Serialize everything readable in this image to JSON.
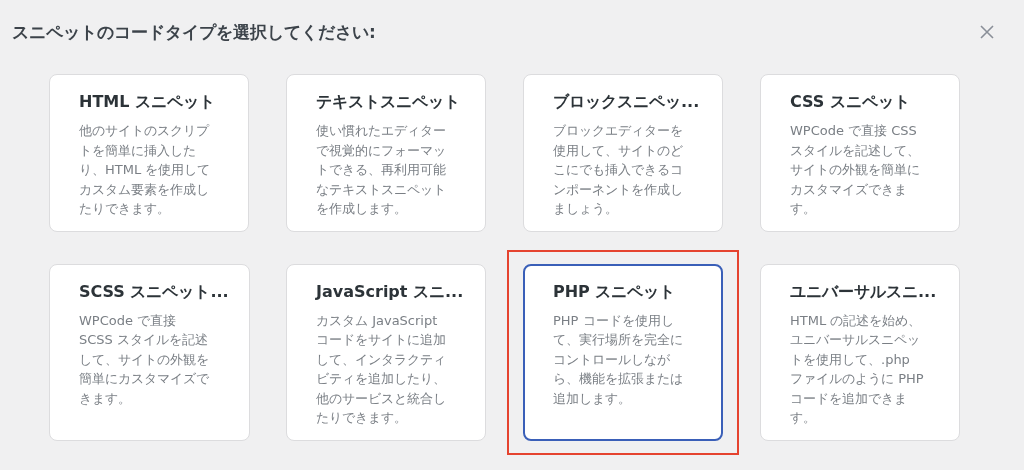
{
  "dialog": {
    "title": "スニペットのコードタイプを選択してください:"
  },
  "cards": [
    {
      "title": "HTML スニペット",
      "description": "他のサイトのスクリプトを簡単に挿入したり、HTML を使用してカスタム要素を作成したりできます。",
      "selected": false,
      "highlighted": false
    },
    {
      "title": "テキストスニペット",
      "description": "使い慣れたエディターで視覚的にフォーマットできる、再利用可能なテキストスニペットを作成します。",
      "selected": false,
      "highlighted": false
    },
    {
      "title": "ブロックスニペッ...",
      "description": "ブロックエディターを使用して、サイトのどこにでも挿入できるコンポーネントを作成しましょう。",
      "selected": false,
      "highlighted": false
    },
    {
      "title": "CSS スニペット",
      "description": "WPCode で直接 CSS スタイルを記述して、サイトの外観を簡単にカスタマイズできます。",
      "selected": false,
      "highlighted": false
    },
    {
      "title": "SCSS スニペット...",
      "description": "WPCode で直接 SCSS スタイルを記述して、サイトの外観を簡単にカスタマイズできます。",
      "selected": false,
      "highlighted": false
    },
    {
      "title": "JavaScript スニ...",
      "description": "カスタム JavaScript コードをサイトに追加して、インタラクティビティを追加したり、他のサービスと統合したりできます。",
      "selected": false,
      "highlighted": false
    },
    {
      "title": "PHP スニペット",
      "description": "PHP コードを使用して、実行場所を完全にコントロールしながら、機能を拡張または追加します。",
      "selected": true,
      "highlighted": true
    },
    {
      "title": "ユニバーサルスニ...",
      "description": "HTML の記述を始め、ユニバーサルスニペットを使用して、.php ファイルのように PHP コードを追加できます。",
      "selected": false,
      "highlighted": false
    }
  ]
}
